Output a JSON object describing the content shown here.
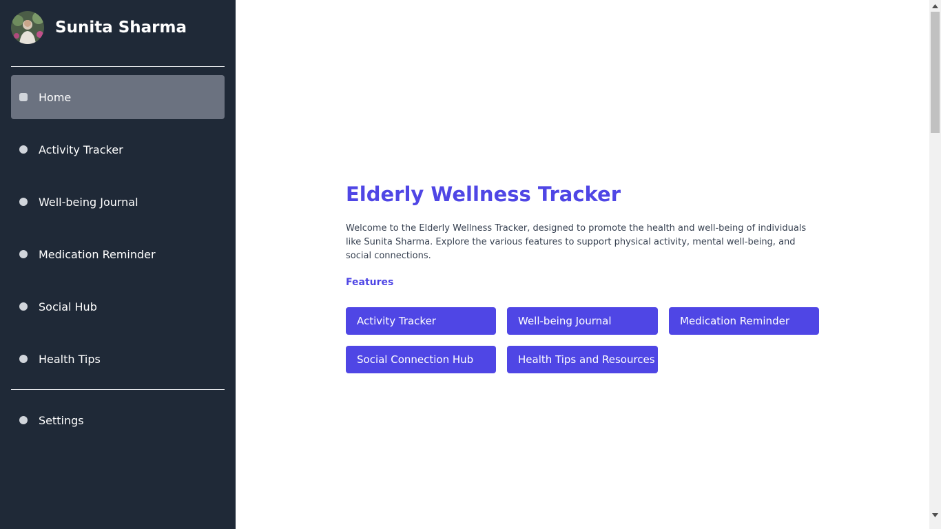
{
  "sidebar": {
    "profile": {
      "name": "Sunita Sharma",
      "avatar_icon": "user-photo-avatar"
    },
    "nav_items": [
      {
        "label": "Home",
        "active": true
      },
      {
        "label": "Activity Tracker",
        "active": false
      },
      {
        "label": "Well-being Journal",
        "active": false
      },
      {
        "label": "Medication Reminder",
        "active": false
      },
      {
        "label": "Social Hub",
        "active": false
      },
      {
        "label": "Health Tips",
        "active": false
      }
    ],
    "settings": {
      "label": "Settings"
    }
  },
  "main": {
    "title": "Elderly Wellness Tracker",
    "intro": "Welcome to the Elderly Wellness Tracker, designed to promote the health and well-being of individuals like Sunita Sharma. Explore the various features to support physical activity, mental well-being, and social connections.",
    "features_heading": "Features",
    "feature_buttons": [
      {
        "label": "Activity Tracker"
      },
      {
        "label": "Well-being Journal"
      },
      {
        "label": "Medication Reminder"
      },
      {
        "label": "Social Connection Hub"
      },
      {
        "label": "Health Tips and Resources"
      }
    ]
  },
  "colors": {
    "sidebar_bg": "#1f2937",
    "active_item_bg": "#6b7280",
    "accent": "#4f46e5",
    "body_text": "#374151"
  },
  "icons": {
    "nav_bullet": "circle-bullet-icon",
    "scroll_up": "triangle-up-icon",
    "scroll_down": "triangle-down-icon"
  }
}
